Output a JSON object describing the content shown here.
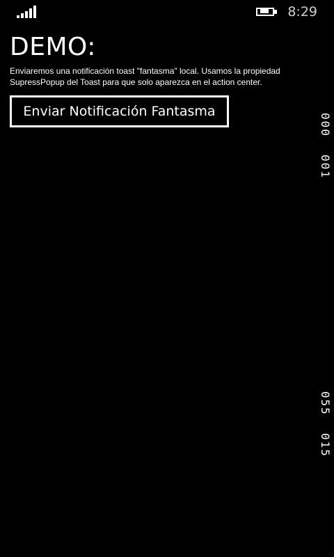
{
  "status_bar": {
    "time": "8:29",
    "signal_icon": "signal-strength-icon",
    "battery_icon": "battery-charging-icon"
  },
  "page": {
    "title": "DEMO:",
    "description": "Enviaremos una notificación toast \"fantasma\" local. Usamos la propiedad SupressPopup del Toast para que solo aparezca en el action center.",
    "button_label": "Enviar Notificación Fantasma"
  },
  "counters": [
    "000",
    "001",
    "055",
    "015"
  ]
}
